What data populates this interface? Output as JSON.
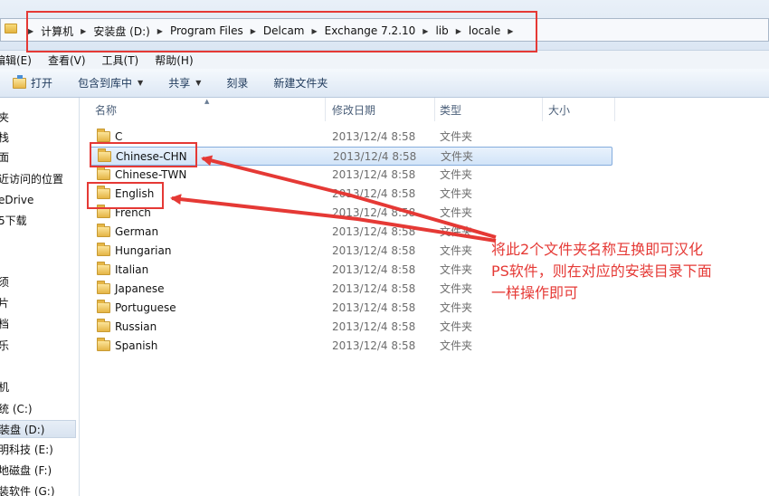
{
  "breadcrumb": {
    "items": [
      "计算机",
      "安装盘 (D:)",
      "Program Files",
      "Delcam",
      "Exchange 7.2.10",
      "lib",
      "locale"
    ]
  },
  "menu": {
    "items": [
      "编辑(E)",
      "查看(V)",
      "工具(T)",
      "帮助(H)"
    ]
  },
  "toolbar": {
    "open_label": "打开",
    "include_label": "包含到库中",
    "share_label": "共享",
    "burn_label": "刻录",
    "new_folder_label": "新建文件夹"
  },
  "nav": {
    "items": [
      "夹",
      "栈",
      "面",
      "近访问的位置",
      "eDrive",
      "5下载",
      "须",
      "片",
      "档",
      "乐",
      "机",
      "统 (C:)",
      "装盘 (D:)",
      "明科技 (E:)",
      "地磁盘 (F:)",
      "装软件 (G:)"
    ],
    "selected": "装盘 (D:)"
  },
  "columns": {
    "name": "名称",
    "date": "修改日期",
    "type": "类型",
    "size": "大小"
  },
  "files": [
    {
      "name": "C",
      "date": "2013/12/4 8:58",
      "type": "文件夹"
    },
    {
      "name": "Chinese-CHN",
      "date": "2013/12/4 8:58",
      "type": "文件夹",
      "selected": true
    },
    {
      "name": "Chinese-TWN",
      "date": "2013/12/4 8:58",
      "type": "文件夹"
    },
    {
      "name": "English",
      "date": "2013/12/4 8:58",
      "type": "文件夹"
    },
    {
      "name": "French",
      "date": "2013/12/4 8:58",
      "type": "文件夹"
    },
    {
      "name": "German",
      "date": "2013/12/4 8:58",
      "type": "文件夹"
    },
    {
      "name": "Hungarian",
      "date": "2013/12/4 8:58",
      "type": "文件夹"
    },
    {
      "name": "Italian",
      "date": "2013/12/4 8:58",
      "type": "文件夹"
    },
    {
      "name": "Japanese",
      "date": "2013/12/4 8:58",
      "type": "文件夹"
    },
    {
      "name": "Portuguese",
      "date": "2013/12/4 8:58",
      "type": "文件夹"
    },
    {
      "name": "Russian",
      "date": "2013/12/4 8:58",
      "type": "文件夹"
    },
    {
      "name": "Spanish",
      "date": "2013/12/4 8:58",
      "type": "文件夹"
    }
  ],
  "annotation": {
    "lines": [
      "将此2个文件夹名称互换即可汉化",
      "PS软件，则在对应的安装目录下面",
      "一样操作即可"
    ],
    "color": "#e53935"
  },
  "colors": {
    "selection": "#cfe3f8",
    "annotation_red": "#e53935"
  }
}
